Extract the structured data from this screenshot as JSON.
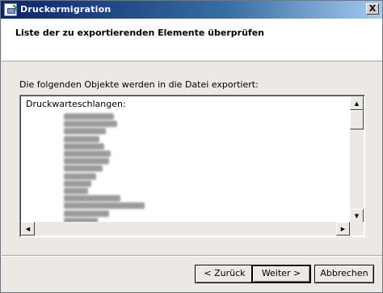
{
  "window": {
    "title": "Druckermigration",
    "close_label": "X"
  },
  "header": {
    "title": "Liste der zu exportierenden Elemente überprüfen"
  },
  "main": {
    "description": "Die folgenden Objekte werden in die Datei exportiert:",
    "list_header": "Druckwarteschlangen:",
    "hidden_item_count": 15
  },
  "buttons": {
    "back": "< Zurück",
    "next": "Weiter >",
    "cancel": "Abbrechen"
  },
  "icons": {
    "window_icon": "printer-migration-icon",
    "scroll_up": "up-arrow-icon",
    "scroll_down": "down-arrow-icon",
    "scroll_left": "left-arrow-icon",
    "scroll_right": "right-arrow-icon"
  }
}
